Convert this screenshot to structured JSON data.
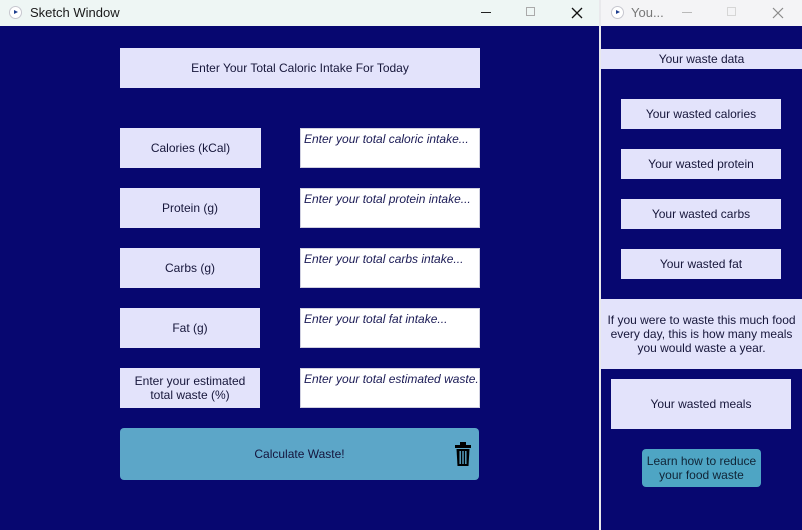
{
  "main_window": {
    "title": "Sketch Window",
    "header_label": "Enter Your Total Caloric Intake For Today",
    "rows": [
      {
        "label": "Calories (kCal)",
        "placeholder": "Enter your total caloric intake..."
      },
      {
        "label": "Protein (g)",
        "placeholder": "Enter your total protein intake..."
      },
      {
        "label": "Carbs (g)",
        "placeholder": "Enter your total carbs intake..."
      },
      {
        "label": "Fat (g)",
        "placeholder": "Enter your total fat intake..."
      },
      {
        "label": "Enter your estimated total waste (%)",
        "placeholder": "Enter your total estimated waste..."
      }
    ],
    "calculate_label": "Calculate Waste!",
    "trash_icon": "trash-icon"
  },
  "side_window": {
    "title": "You...",
    "header_label": "Your waste data",
    "items": [
      "Your wasted calories",
      "Your wasted protein",
      "Your wasted carbs",
      "Your wasted fat"
    ],
    "info_text": "If you were to waste this much food every day, this is how many meals you would waste a year.",
    "meals_label": "Your wasted meals",
    "learn_label": "Learn how to reduce your food waste"
  },
  "colors": {
    "background": "#070770",
    "label_box": "#e3e3fb",
    "button": "#5ca6c8"
  }
}
